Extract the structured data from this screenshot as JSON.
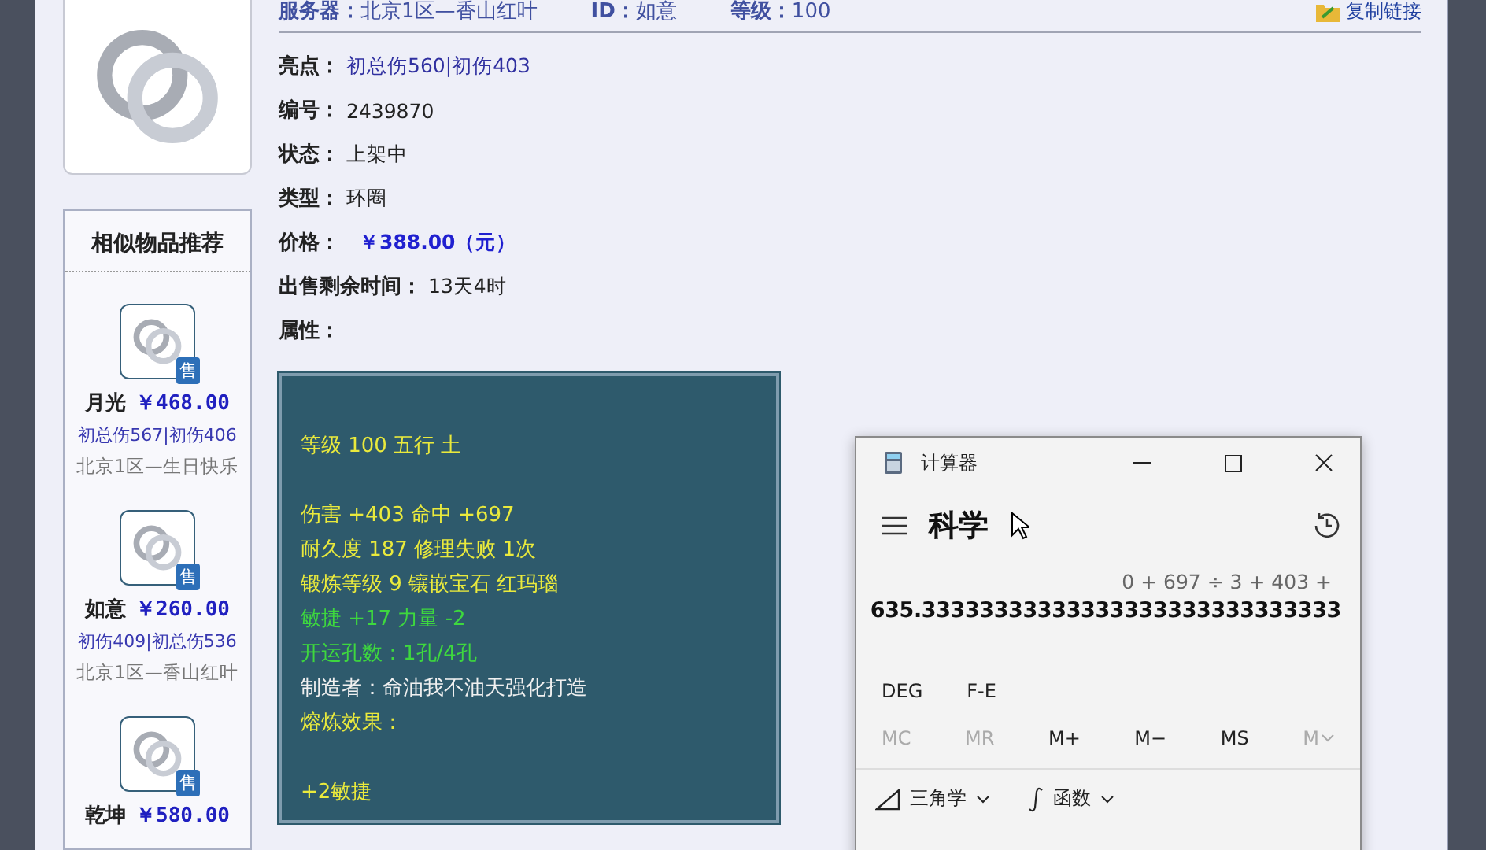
{
  "header": {
    "server_label": "服务器：",
    "server": "北京1区—香山红叶",
    "id_label": "ID：",
    "id": "如意",
    "level_label": "等级：",
    "level": "100",
    "copy_link": "复制链接"
  },
  "fields": [
    {
      "label": "亮点：",
      "value": "初总伤560|初伤403",
      "kind": "link"
    },
    {
      "label": "编号：",
      "value": "2439870",
      "kind": "plain"
    },
    {
      "label": "状态：",
      "value": "上架中",
      "kind": "plain"
    },
    {
      "label": "类型：",
      "value": "环圈",
      "kind": "plain"
    },
    {
      "label": "价格：",
      "value": "￥388.00（元）",
      "kind": "price"
    },
    {
      "label": "出售剩余时间：",
      "value": "13天4时",
      "kind": "plain"
    },
    {
      "label": "属性："
    }
  ],
  "attributes": [
    {
      "lines": [
        {
          "text": "等级 100 五行 土",
          "kind": "yellow"
        }
      ]
    },
    {
      "lines": [
        {
          "text": "伤害 +403 命中 +697",
          "kind": "yellow"
        },
        {
          "text": "耐久度 187 修理失败 1次",
          "kind": "yellow"
        },
        {
          "text": "锻炼等级 9 镶嵌宝石 红玛瑙",
          "kind": "yellow"
        },
        {
          "text": "敏捷 +17 力量 -2",
          "kind": "green"
        },
        {
          "text": "开运孔数：1孔/4孔",
          "kind": "green"
        },
        {
          "text": "制造者：命油我不油天强化打造",
          "kind": "white"
        },
        {
          "text": "熔炼效果：",
          "kind": "yellow"
        }
      ]
    },
    {
      "lines": [
        {
          "text": "+2敏捷",
          "kind": "yellow"
        }
      ]
    }
  ],
  "similar": {
    "title": "相似物品推荐",
    "items": [
      {
        "badge": "售",
        "name": "月光",
        "price": "￥468.00",
        "stats": "初总伤567|初伤406",
        "server": "北京1区—生日快乐"
      },
      {
        "badge": "售",
        "name": "如意",
        "price": "￥260.00",
        "stats": "初伤409|初总伤536",
        "server": "北京1区—香山红叶"
      },
      {
        "badge": "售",
        "name": "乾坤",
        "price": "￥580.00"
      }
    ]
  },
  "calculator": {
    "title": "计算器",
    "mode": "科学",
    "expression": "0 + 697 ÷ 3 + 403 +",
    "result": "635.33333333333333333333333333333",
    "modes": [
      "DEG",
      "F-E"
    ],
    "memory": [
      {
        "label": "MC",
        "disabled": true
      },
      {
        "label": "MR",
        "disabled": true
      },
      {
        "label": "M+",
        "disabled": false
      },
      {
        "label": "M−",
        "disabled": false
      },
      {
        "label": "MS",
        "disabled": false
      },
      {
        "label": "M",
        "disabled": true
      }
    ],
    "toolbar": [
      {
        "label": "三角学",
        "kind": "trig"
      },
      {
        "label": "函数",
        "kind": "func"
      }
    ]
  }
}
